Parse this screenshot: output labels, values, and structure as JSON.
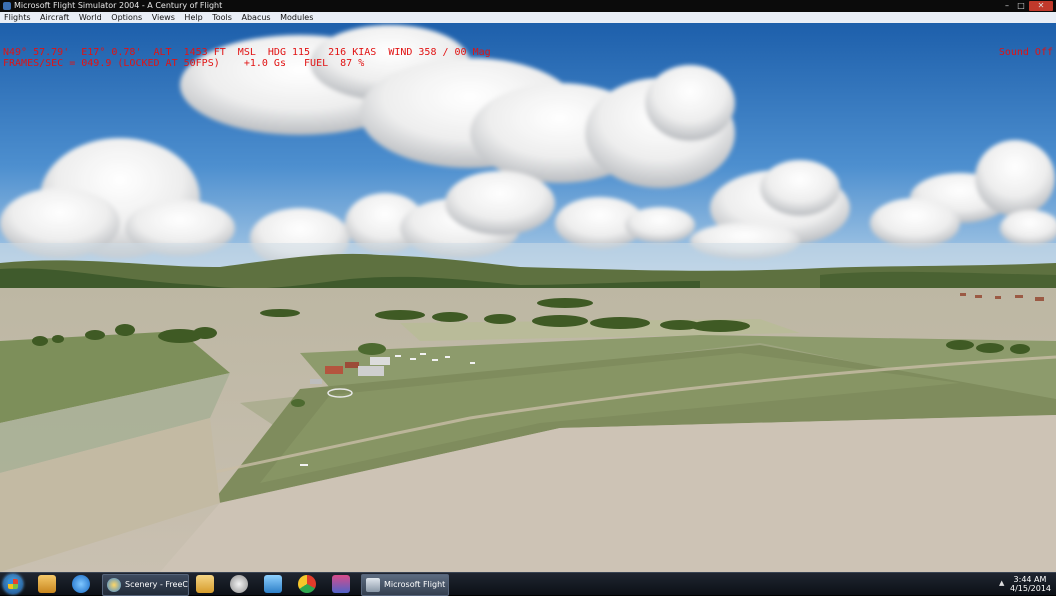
{
  "window": {
    "title": "Microsoft Flight Simulator 2004 - A Century of Flight",
    "controls": {
      "minimize": "–",
      "maximize": "□",
      "close": "✕"
    }
  },
  "menu": {
    "items": [
      "Flights",
      "Aircraft",
      "World",
      "Options",
      "Views",
      "Help",
      "Tools",
      "Abacus",
      "Modules"
    ]
  },
  "hud": {
    "line1": "N49° 57.79'  E17° 0.78'  ALT  1453 FT  MSL  HDG 115   216 KIAS  WIND 358 / 00 Mag",
    "line2": "FRAMES/SEC = 049.9 (LOCKED AT 50FPS)    +1.0 Gs   FUEL  87 %",
    "sound": "Sound Off",
    "color": "#e11313"
  },
  "taskbar": {
    "start_icon": "windows-start-orb",
    "pinned_icons": [
      "media-player-icon",
      "internet-explorer-icon",
      "file-explorer-icon",
      "paint-icon",
      "remote-desktop-icon",
      "color-app-icon",
      "network-app-icon"
    ],
    "tasks": [
      {
        "label": "Scenery - FreeCo...",
        "icon": "globe-icon"
      },
      {
        "label": "Microsoft Flight S...",
        "icon": "airplane-icon"
      }
    ],
    "clock_time": "3:44 AM",
    "clock_date": "4/15/2014"
  }
}
